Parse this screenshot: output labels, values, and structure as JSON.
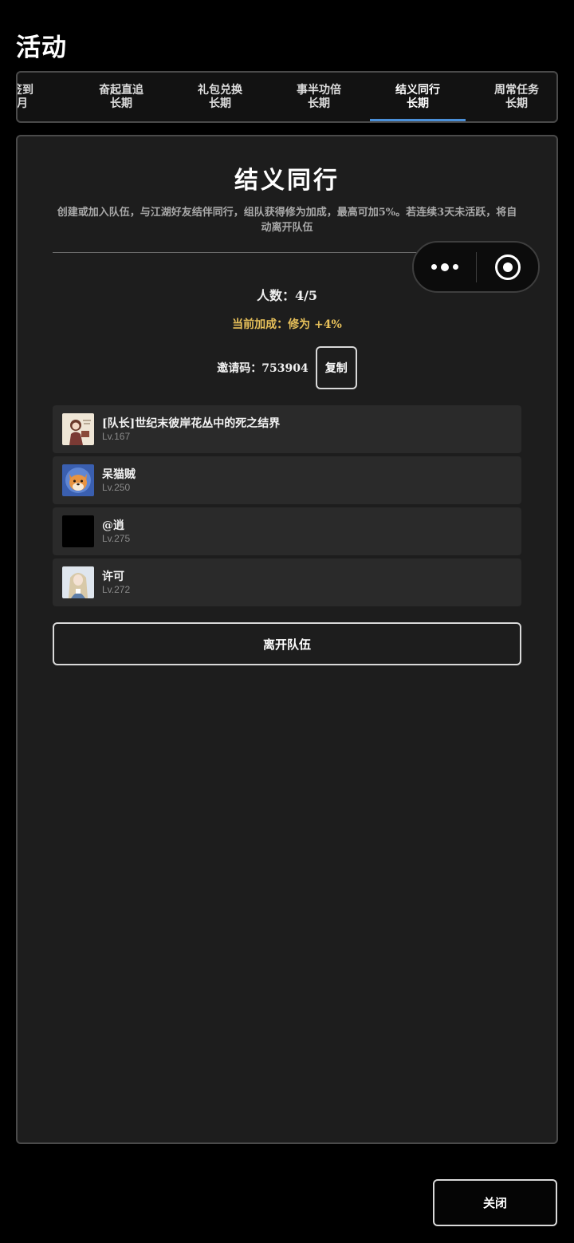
{
  "page": {
    "title": "活动"
  },
  "tabs": [
    {
      "line1": "签到",
      "line2": "月"
    },
    {
      "line1": "奋起直追",
      "line2": "长期"
    },
    {
      "line1": "礼包兑换",
      "line2": "长期"
    },
    {
      "line1": "事半功倍",
      "line2": "长期"
    },
    {
      "line1": "结义同行",
      "line2": "长期",
      "active": true
    },
    {
      "line1": "周常任务",
      "line2": "长期"
    }
  ],
  "panel": {
    "title": "结义同行",
    "description": "创建或加入队伍，与江湖好友结伴同行，组队获得修为加成，最高可加5%。若连续3天未活跃，将自动离开队伍",
    "member_count": "人数：4/5",
    "bonus": "当前加成：修为 +4%",
    "invite_code": "邀请码：753904",
    "copy_label": "复制",
    "leave_label": "离开队伍"
  },
  "members": [
    {
      "name": "[队长]世纪末彼岸花丛中的死之结界",
      "level": "Lv.167",
      "avatar": "avatar-girl-illustration"
    },
    {
      "name": "呆猫贼",
      "level": "Lv.250",
      "avatar": "avatar-shiba-dog"
    },
    {
      "name": "@逍",
      "level": "Lv.275",
      "avatar": "avatar-black"
    },
    {
      "name": "许可",
      "level": "Lv.272",
      "avatar": "avatar-anime-character"
    }
  ],
  "footer": {
    "close_label": "关闭"
  },
  "capsule": {
    "more_icon": "more-dots-icon",
    "close_icon": "target-close-icon"
  }
}
